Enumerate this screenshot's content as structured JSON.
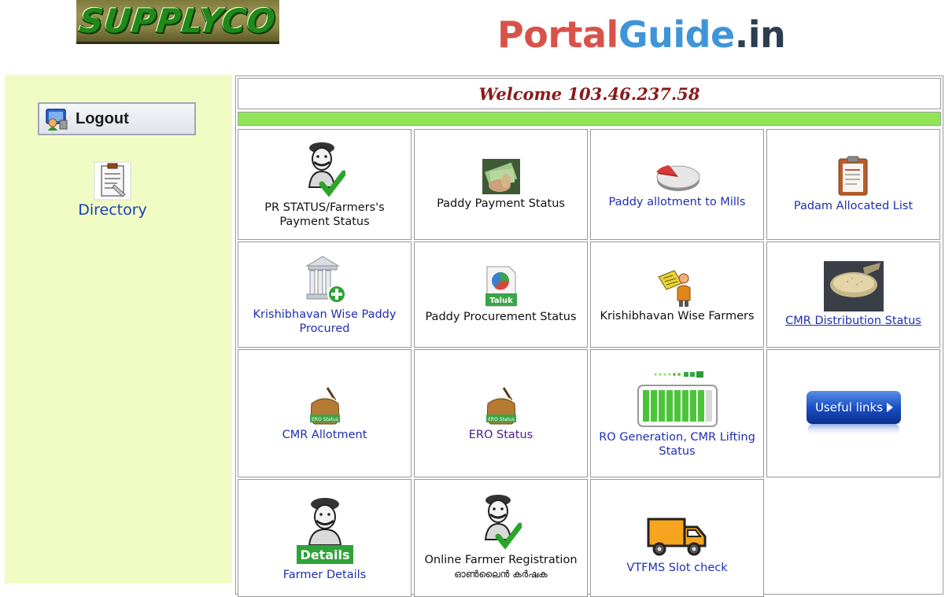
{
  "header": {
    "supplyco_logo_text": "SUPPLYCO",
    "portalguide_part1": "Portal",
    "portalguide_part2": "Guide",
    "portalguide_part3": ".in"
  },
  "sidebar": {
    "logout_label": "Logout",
    "directory_label": "Directory"
  },
  "main": {
    "welcome_text": "Welcome 103.46.237.58",
    "tiles": [
      {
        "label_line1": "PR STATUS/Farmers's",
        "label_line2": "Payment Status",
        "icon": "farmer-check-icon"
      },
      {
        "label_line1": "Paddy Payment Status",
        "label_line2": "",
        "icon": "money-photo-icon"
      },
      {
        "label_line1": "Paddy allotment to Mills",
        "label_line2": "",
        "icon": "pie-chart-icon"
      },
      {
        "label_line1": "Padam Allocated List",
        "label_line2": "",
        "icon": "clipboard-icon"
      },
      {
        "label_line1": "Krishibhavan Wise Paddy",
        "label_line2": "Procured",
        "icon": "bank-add-icon"
      },
      {
        "label_line1": "Paddy Procurement Status",
        "label_line2": "",
        "icon": "taluk-report-icon",
        "badge": "Taluk"
      },
      {
        "label_line1": "Krishibhavan Wise Farmers",
        "label_line2": "",
        "icon": "person-map-icon"
      },
      {
        "label_line1": "CMR Distribution Status",
        "label_line2": "",
        "icon": "rice-bowl-photo-icon"
      },
      {
        "label_line1": "CMR Allotment",
        "label_line2": "",
        "icon": "rice-sack-icon",
        "badge": "ERO Status"
      },
      {
        "label_line1": "ERO Status",
        "label_line2": "",
        "icon": "rice-sack-icon",
        "badge": "ERO Status"
      },
      {
        "label_line1": "RO Generation, CMR Lifting",
        "label_line2": "Status",
        "icon": "battery-progress-icon"
      },
      {
        "label_line1": "",
        "label_line2": "",
        "icon": "useful-links-button",
        "button_text": "Useful links"
      },
      {
        "label_line1": "Farmer Details",
        "label_line2": "",
        "icon": "farmer-details-icon",
        "badge": "Details"
      },
      {
        "label_line1": "Online Farmer Registration",
        "label_line2": "ഓൺലൈൻ കർഷക",
        "icon": "farmer-check-icon"
      },
      {
        "label_line1": "VTFMS Slot check",
        "label_line2": "",
        "icon": "delivery-truck-icon"
      }
    ]
  },
  "colors": {
    "sidebar_bg": "#f1fbc4",
    "green_bar": "#8fe557",
    "welcome_text": "#8a1a1a",
    "link_blue": "#1f2fb0",
    "directory_blue": "#1a41b8"
  }
}
